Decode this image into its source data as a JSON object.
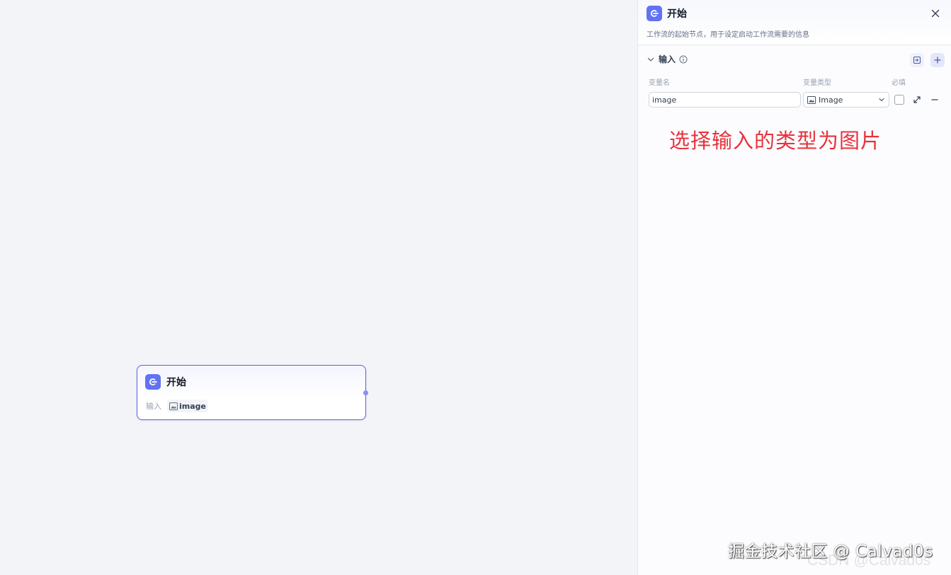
{
  "canvas": {
    "node": {
      "title": "开始",
      "input_label": "输入",
      "variable": "image",
      "icon": "start-icon"
    }
  },
  "panel": {
    "title": "开始",
    "description": "工作流的起始节点，用于设定启动工作流需要的信息",
    "icon": "start-icon",
    "input_section": {
      "title": "输入",
      "columns": {
        "name": "变量名",
        "type": "变量类型",
        "required": "必填"
      },
      "rows": [
        {
          "name": "image",
          "type": "Image",
          "required": false
        }
      ]
    }
  },
  "annotation": "选择输入的类型为图片",
  "watermarks": {
    "primary": "掘金技术社区 @ Calvad0s",
    "secondary": "CSDN @Calvad0s"
  },
  "colors": {
    "accent": "#6172f3",
    "node_border": "#5b5fe8",
    "annotation": "#e8323c"
  }
}
